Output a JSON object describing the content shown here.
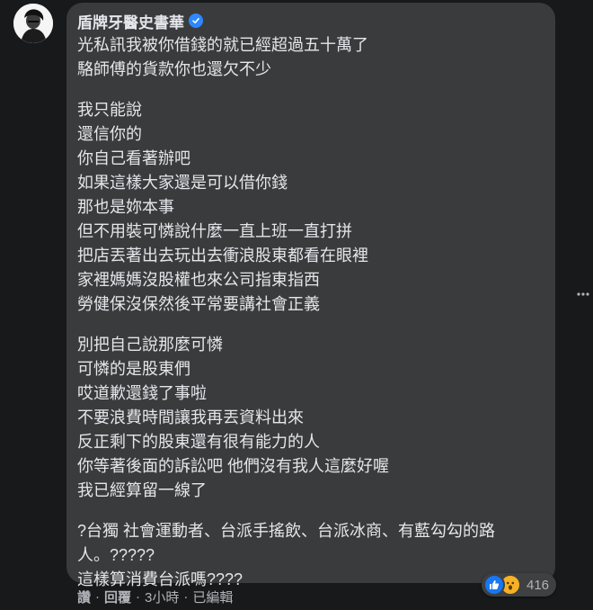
{
  "comment": {
    "author": "盾牌牙醫史書華",
    "paragraphs": [
      [
        "光私訊我被你借錢的就已經超過五十萬了",
        "駱師傅的貨款你也還欠不少"
      ],
      [
        "我只能說",
        "還信你的",
        "你自己看著辦吧",
        "如果這樣大家還是可以借你錢",
        "那也是妳本事",
        "但不用裝可憐說什麼一直上班一直打拼",
        "把店丟著出去玩出去衝浪股東都看在眼裡",
        "家裡媽媽沒股權也來公司指東指西",
        "勞健保沒保然後平常要講社會正義"
      ],
      [
        "別把自己說那麼可憐",
        "可憐的是股東們",
        "哎道歉還錢了事啦",
        "不要浪費時間讓我再丟資料出來",
        "反正剩下的股東還有很有能力的人",
        "你等著後面的訴訟吧 他們沒有我人這麼好喔",
        "我已經算留一線了"
      ],
      [
        "?台獨 社會運動者、台派手搖飲、台派冰商、有藍勾勾的路",
        "人。?????",
        "這樣算消費台派嗎????"
      ]
    ],
    "reaction_count": "416",
    "reaction_icons": [
      "like-icon",
      "wow-icon"
    ]
  },
  "actions": {
    "like": "讚",
    "reply": "回覆",
    "sep": "·",
    "time": "3小時",
    "edited": "已編輯"
  },
  "colors": {
    "background": "#18191a",
    "bubble": "#3a3b3c",
    "text": "#e4e6eb",
    "secondary": "#b0b3b8",
    "like_blue": "#1877f2",
    "wow_yellow": "#f7b125"
  }
}
